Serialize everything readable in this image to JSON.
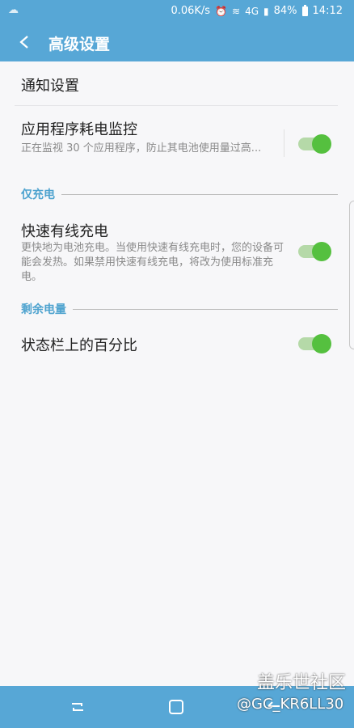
{
  "status_bar": {
    "speed": "0.06K/s",
    "network": "4G",
    "battery": "84%",
    "time": "14:12"
  },
  "header": {
    "title": "高级设置"
  },
  "items": {
    "notifications": "通知设置",
    "power_monitor": {
      "title": "应用程序耗电监控",
      "desc": "正在监视 30 个应用程序，防止其电池使用量过高...",
      "enabled": true
    },
    "fast_charging": {
      "title": "快速有线充电",
      "desc": "更快地为电池充电。当使用快速有线充电时，您的设备可能会发热。如果禁用快速有线充电，将改为使用标准充电。",
      "enabled": true
    },
    "percentage": {
      "title": "状态栏上的百分比",
      "enabled": true
    }
  },
  "sections": {
    "charging_only": "仅充电",
    "remaining_power": "剩余电量"
  },
  "watermark": {
    "site": "盖乐世社区",
    "user": "@GC_KR6LL30"
  },
  "colors": {
    "header_bg": "#57a7d6",
    "toggle_on": "#55c03f",
    "section_label": "#4ea3cf"
  }
}
